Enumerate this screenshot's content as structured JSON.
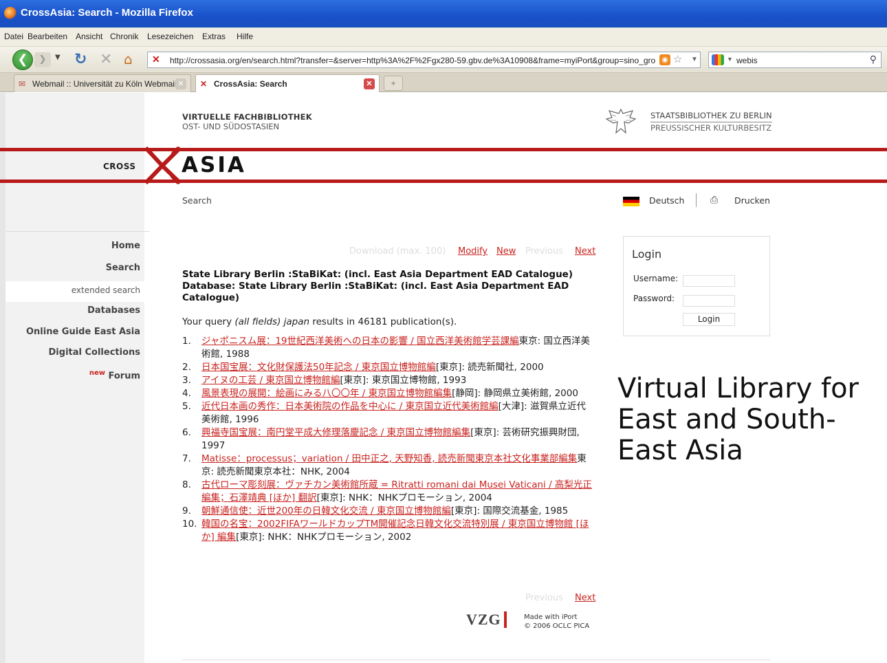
{
  "window": {
    "title": "CrossAsia: Search - Mozilla Firefox"
  },
  "menu": [
    "Datei",
    "Bearbeiten",
    "Ansicht",
    "Chronik",
    "Lesezeichen",
    "Extras",
    "Hilfe"
  ],
  "address": {
    "url": "http://crossasia.org/en/search.html?transfer=&server=http%3A%2F%2Fgx280-59.gbv.de%3A10908&frame=myiPort&group=sino_gro"
  },
  "search": {
    "engine": "google-icon",
    "value": "webis"
  },
  "tabs": [
    {
      "label": "Webmail :: Universität zu Köln Webmail",
      "icon": "envelope-icon"
    },
    {
      "label": "CrossAsia: Search",
      "icon": "crossasia-x-icon"
    }
  ],
  "header": {
    "vfb_line1": "VIRTUELLE FACHBIBLIOTHEK",
    "vfb_line2": "OST- UND SÜDOSTASIEN",
    "sbb_line1": "STAATSBIBLIOTHEK ZU BERLIN",
    "sbb_line2": "PREUSSISCHER KULTURBESITZ",
    "cross": "CROSS",
    "asia": "ASIA",
    "accent": "#b81a1a"
  },
  "breadcrumb": "Search",
  "lang": {
    "label": "Deutsch"
  },
  "print": {
    "label": "Drucken"
  },
  "sidebar": {
    "home": "Home",
    "search": "Search",
    "extended": "extended search",
    "databases": "Databases",
    "guide": "Online Guide East Asia",
    "digital": "Digital Collections",
    "new_badge": "new",
    "forum": "Forum"
  },
  "result_nav": {
    "download": "Download (max. 100)",
    "modify": "Modify",
    "new": "New",
    "previous": "Previous",
    "next": "Next"
  },
  "library_line": "State Library Berlin :StaBiKat: (incl. East Asia Department EAD Catalogue)",
  "database_line": "Database: State Library Berlin :StaBiKat: (incl. East Asia Department EAD Catalogue)",
  "query": {
    "prefix": "Your query ",
    "terms": "(all fields) japan",
    "suffix": " results in 46181 publication(s)."
  },
  "results": [
    {
      "num": "1.",
      "title": "ジャポニスム展：19世紀西洋美術への日本の影響 / 国立西洋美術館学芸課編",
      "rest": "東京: 国立西洋美術館, 1988"
    },
    {
      "num": "2.",
      "title": "日本国宝展：文化財保護法50年記念 / 東京国立博物館編",
      "rest": "[東京]: 読売新聞社, 2000"
    },
    {
      "num": "3.",
      "title": "アイヌの工芸 / 東京国立博物館編",
      "rest": "[東京]: 東京国立博物館, 1993"
    },
    {
      "num": "4.",
      "title": "風景表現の展開：絵画にみる八〇〇年 / 東京国立博物館編集",
      "rest": "[静岡]: 静岡県立美術館, 2000"
    },
    {
      "num": "5.",
      "title": "近代日本画の秀作：日本美術院の作品を中心に / 東京国立近代美術館編",
      "rest": "[大津]: 滋賀県立近代美術館, 1996"
    },
    {
      "num": "6.",
      "title": "興福寺国宝展：南円堂平成大修理落慶記念 / 東京国立博物館編集",
      "rest": "[東京]: 芸術研究振興財団, 1997"
    },
    {
      "num": "7.",
      "title": "Matisse：processus；variation / 田中正之, 天野知香, 読売新聞東京本社文化事業部編集",
      "rest": "東京: 読売新聞東京本社：NHK, 2004"
    },
    {
      "num": "8.",
      "title": "古代ローマ彫刻展：ヴァチカン美術館所蔵 = Ritratti romani dai Musei Vaticani / 高梨光正編集；石澤靖典 [ほか] 翻訳",
      "rest": "[東京]: NHK：NHKプロモーション, 2004"
    },
    {
      "num": "9.",
      "title": "朝鮮通信使：近世200年の日韓文化交流 / 東京国立博物館編",
      "rest": "[東京]: 国際交流基金, 1985"
    },
    {
      "num": "10.",
      "title": "韓国の名宝：2002FIFAワールドカップTM開催記念日韓文化交流特別展 / 東京国立博物館 [ほか] 編集",
      "rest": "[東京]: NHK：NHKプロモーション, 2002"
    }
  ],
  "bottom_nav": {
    "previous": "Previous",
    "next": "Next"
  },
  "footer": {
    "vzg": "VZG",
    "made_with": "Made with iPort",
    "copyright": "© 2006 OCLC PICA"
  },
  "login": {
    "heading": "Login",
    "username_label": "Username:",
    "password_label": "Password:",
    "button": "Login"
  },
  "caption": "Virtual Library for East and South-East Asia"
}
